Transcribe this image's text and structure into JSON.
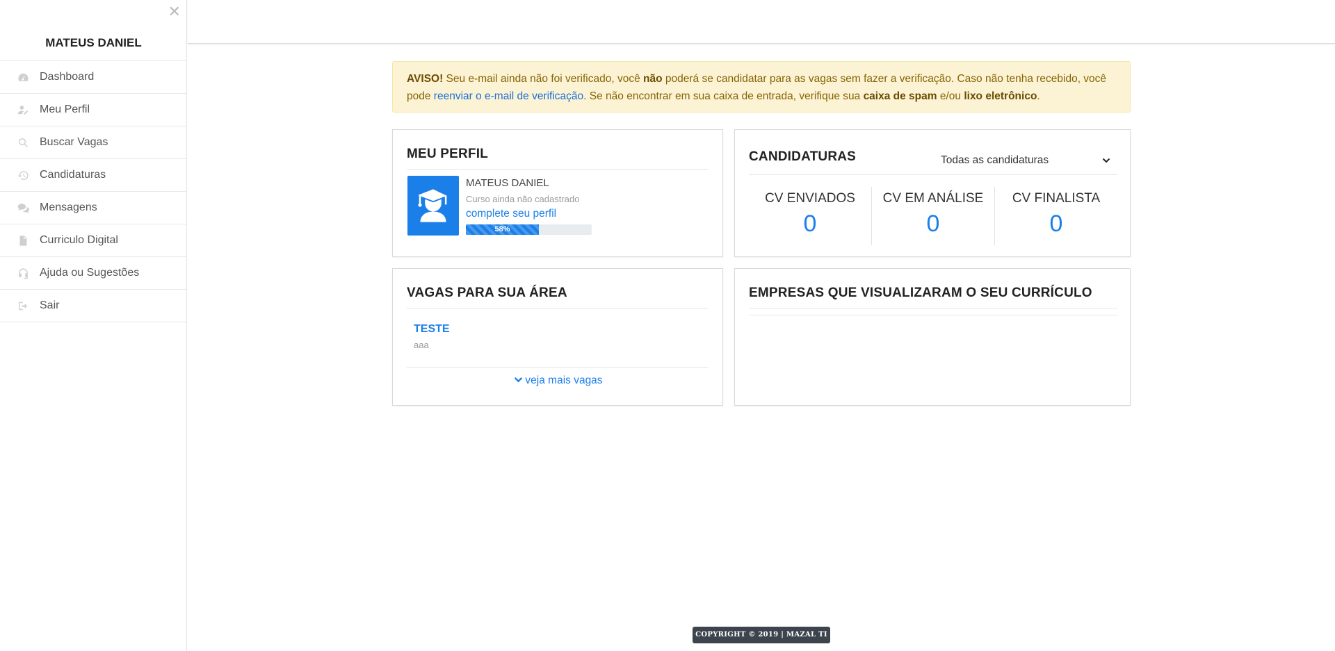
{
  "sidebar": {
    "close_icon": "close-icon",
    "user_name": "MATEUS DANIEL",
    "items": [
      {
        "label": "Dashboard",
        "icon": "dashboard-icon"
      },
      {
        "label": "Meu Perfil",
        "icon": "user-edit-icon"
      },
      {
        "label": "Buscar Vagas",
        "icon": "search-icon"
      },
      {
        "label": "Candidaturas",
        "icon": "history-icon"
      },
      {
        "label": "Mensagens",
        "icon": "comments-icon"
      },
      {
        "label": "Curriculo Digital",
        "icon": "file-icon"
      },
      {
        "label": "Ajuda ou Sugestões",
        "icon": "headset-icon"
      },
      {
        "label": "Sair",
        "icon": "sign-out-icon"
      }
    ]
  },
  "alert": {
    "prefix": "AVISO!",
    "text1": " Seu e-mail ainda não foi verificado, você ",
    "bold1": "não",
    "text2": " poderá se candidatar para as vagas sem fazer a verificação. Caso não tenha recebido, você pode ",
    "link": "reenviar o e-mail de verificação",
    "text3": ". Se não encontrar em sua caixa de entrada, verifique sua ",
    "bold2": "caixa de spam",
    "text4": " e/ou ",
    "bold3": "lixo eletrônico",
    "text5": "."
  },
  "profile": {
    "title": "MEU PERFIL",
    "name": "MATEUS DANIEL",
    "course": "Curso ainda não cadastrado",
    "complete_link": "complete seu perfil",
    "progress_label": "58%",
    "progress_value": 58,
    "avatar_icon": "graduate-icon"
  },
  "candidaturas": {
    "title": "CANDIDATURAS",
    "filter_selected": "Todas as candidaturas",
    "stats": [
      {
        "label": "CV ENVIADOS",
        "value": "0"
      },
      {
        "label": "CV EM ANÁLISE",
        "value": "0"
      },
      {
        "label": "CV FINALISTA",
        "value": "0"
      }
    ]
  },
  "vagas": {
    "title": "VAGAS PARA SUA ÁREA",
    "jobs": [
      {
        "title": "TESTE",
        "subtitle": "aaa"
      }
    ],
    "more_label": "veja mais vagas"
  },
  "empresas": {
    "title": "EMPRESAS QUE VISUALIZARAM O SEU CURRÍCULO"
  },
  "footer": {
    "text": "COPYRIGHT © 2019 | MAZAL TI"
  },
  "colors": {
    "accent": "#1a7fe8",
    "alert_bg": "#fcf3d4",
    "alert_text": "#856404",
    "footer_bg": "#3d444e"
  }
}
